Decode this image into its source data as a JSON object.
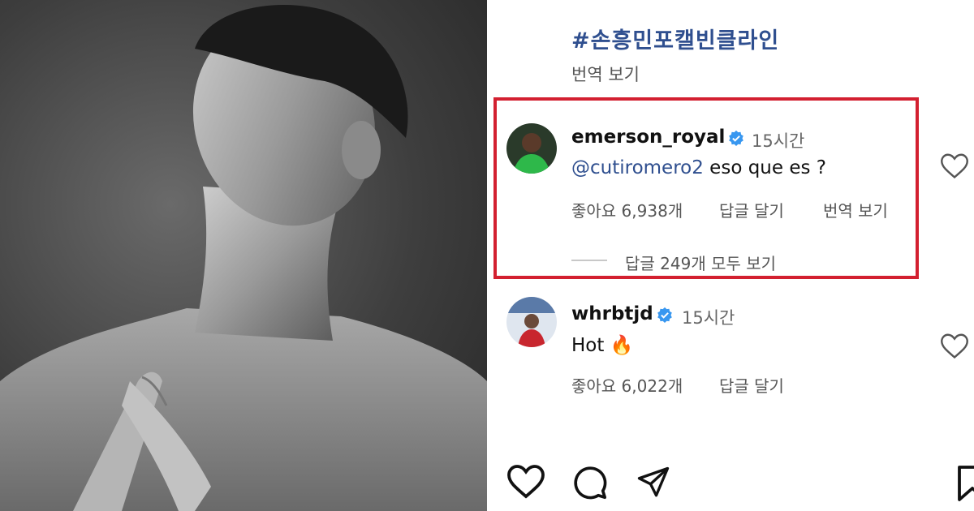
{
  "post": {
    "hashtag": "#손흥민포캘빈클라인",
    "translate_label": "번역 보기"
  },
  "comments": [
    {
      "username": "emerson_royal",
      "time": "15시간",
      "mention": "@cutiromero2",
      "text": " eso que es ?",
      "likes_label": "좋아요 6,938개",
      "reply_label": "답글 달기",
      "translate_label": "번역 보기",
      "view_replies_label": "답글 249개 모두 보기"
    },
    {
      "username": "whrbtjd",
      "time": "15시간",
      "text": "Hot 🔥",
      "likes_label": "좋아요 6,022개",
      "reply_label": "답글 달기"
    }
  ],
  "icons": {
    "verified": "verified-badge-icon",
    "like": "heart-icon",
    "comment": "comment-icon",
    "share": "send-icon",
    "save": "bookmark-icon"
  },
  "colors": {
    "highlight_border": "#d32030",
    "verified_blue": "#3897f0",
    "link_blue": "#2f4f8f"
  }
}
